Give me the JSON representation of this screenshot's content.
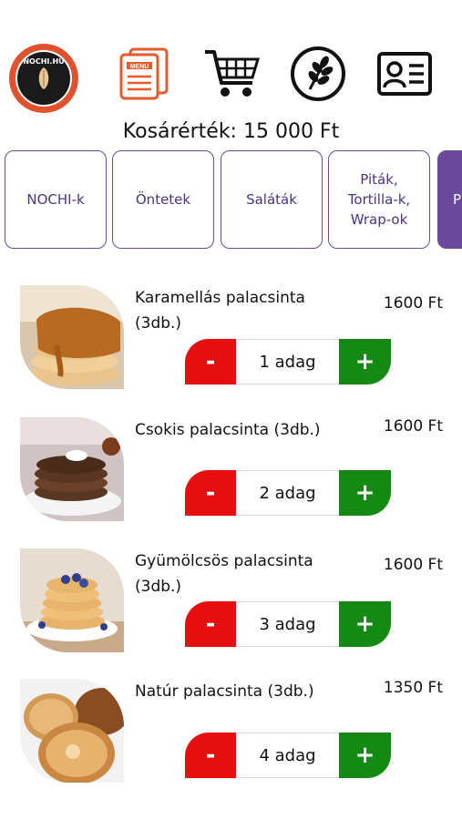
{
  "header": {
    "logo_text": "NOCHI.HU",
    "icons": [
      "logo",
      "menu-icon",
      "cart-icon",
      "wheat-icon",
      "profile-card-icon"
    ]
  },
  "cart": {
    "label": "Kosárérték: 15 000 Ft"
  },
  "categories": [
    {
      "label": "NOCHI-k"
    },
    {
      "label": "Öntetek"
    },
    {
      "label": "Saláták"
    },
    {
      "label": "Piták,\nTortilla-k,\nWrap-ok"
    },
    {
      "label": "P"
    }
  ],
  "items": [
    {
      "name": "Karamellás palacsinta (3db.)",
      "price": "1600 Ft",
      "quantity": "1 adag",
      "minus": "-",
      "plus": "+"
    },
    {
      "name": "Csokis palacsinta (3db.)",
      "price": "1600 Ft",
      "quantity": "2 adag",
      "minus": "-",
      "plus": "+"
    },
    {
      "name": "Gyümölcsös palacsinta (3db.)",
      "price": "1600 Ft",
      "quantity": "3 adag",
      "minus": "-",
      "plus": "+"
    },
    {
      "name": "Natúr palacsinta (3db.)",
      "price": "1350 Ft",
      "quantity": "4 adag",
      "minus": "-",
      "plus": "+"
    }
  ],
  "colors": {
    "accent": "#6b4a9b",
    "minus": "#e50f0f",
    "plus": "#148a14",
    "logo": "#e0522d"
  }
}
